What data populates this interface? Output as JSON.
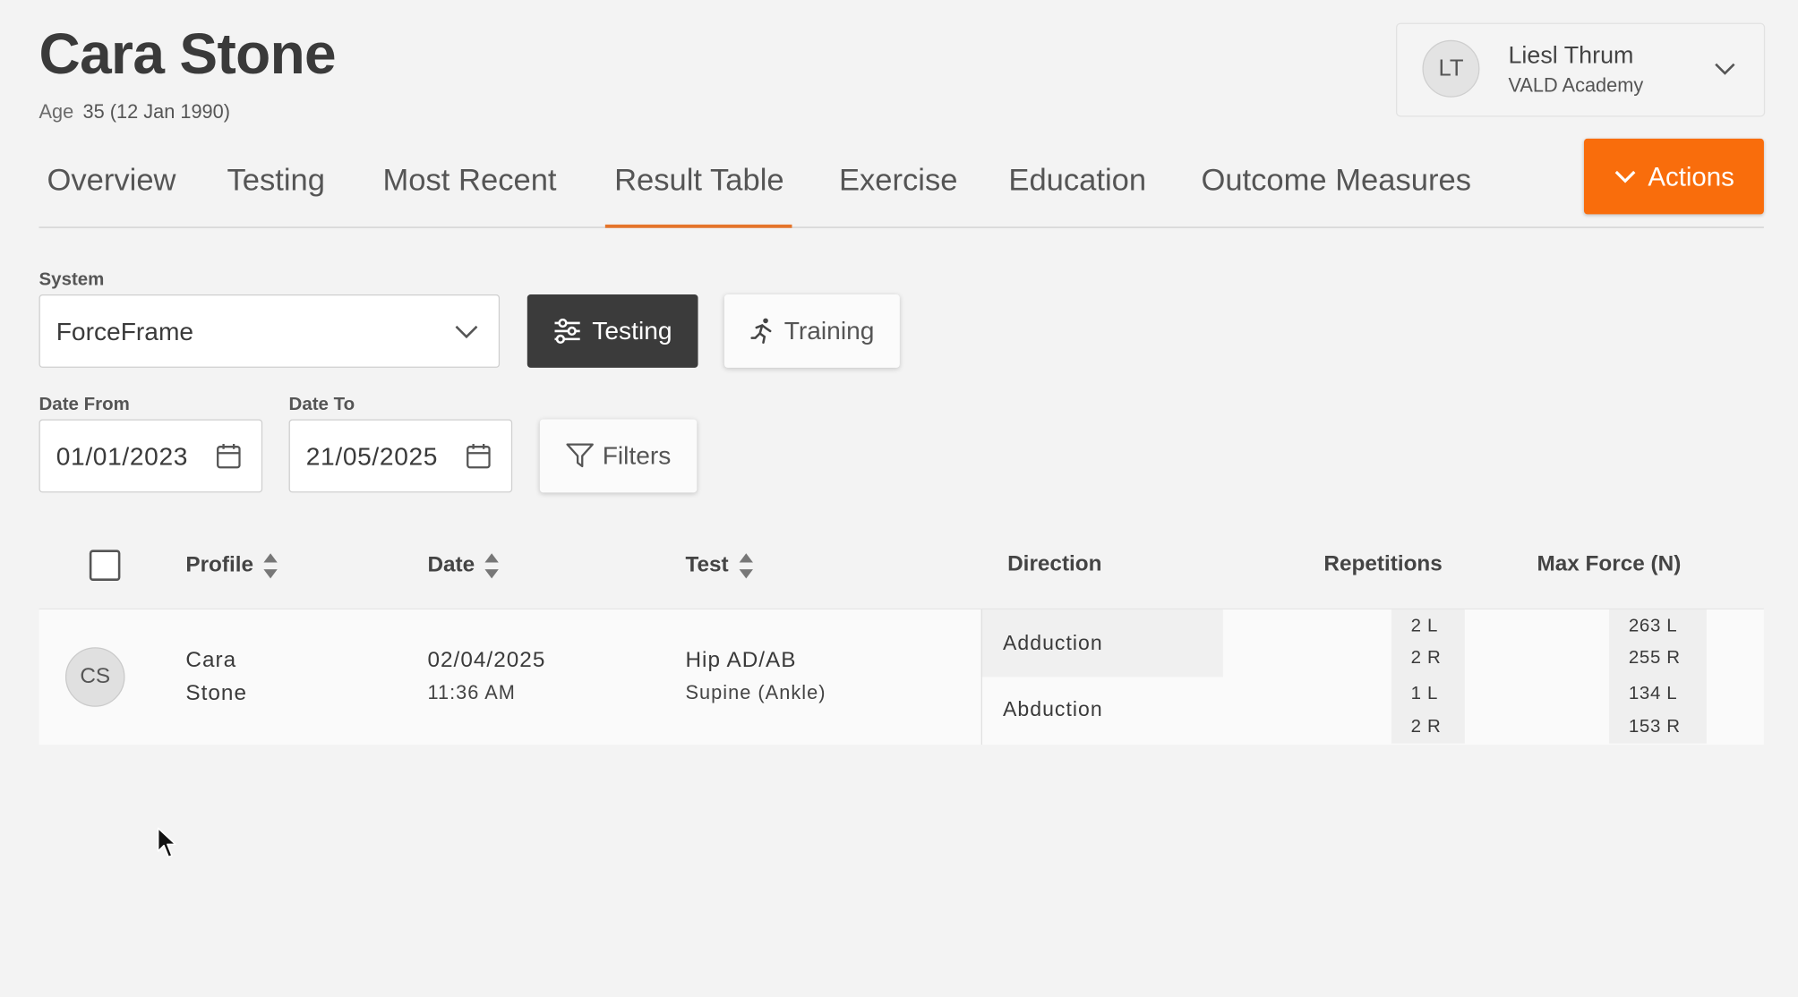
{
  "athlete": {
    "name": "Cara Stone",
    "age_label": "Age",
    "age_value": "35 (12 Jan 1990)"
  },
  "user": {
    "initials": "LT",
    "name": "Liesl Thrum",
    "org": "VALD Academy"
  },
  "tabs": [
    {
      "label": "Overview"
    },
    {
      "label": "Testing"
    },
    {
      "label": "Most Recent"
    },
    {
      "label": "Result Table",
      "active": true
    },
    {
      "label": "Exercise"
    },
    {
      "label": "Education"
    },
    {
      "label": "Outcome Measures"
    }
  ],
  "actions_label": "Actions",
  "filters": {
    "system_label": "System",
    "system_value": "ForceFrame",
    "testing_label": "Testing",
    "training_label": "Training",
    "date_from_label": "Date From",
    "date_from_value": "01/01/2023",
    "date_to_label": "Date To",
    "date_to_value": "21/05/2025",
    "filters_label": "Filters"
  },
  "table": {
    "headers": {
      "profile": "Profile",
      "date": "Date",
      "test": "Test",
      "direction": "Direction",
      "repetitions": "Repetitions",
      "max_force": "Max Force (N)"
    },
    "rows": [
      {
        "initials": "CS",
        "first_name": "Cara",
        "last_name": "Stone",
        "date": "02/04/2025",
        "time": "11:36 AM",
        "test": "Hip AD/AB",
        "position": "Supine (Ankle)",
        "directions": [
          {
            "name": "Adduction",
            "reps": [
              "2 L",
              "2 R"
            ],
            "force": [
              "263 L",
              "255 R"
            ]
          },
          {
            "name": "Abduction",
            "reps": [
              "1 L",
              "2 R"
            ],
            "force": [
              "134 L",
              "153 R"
            ]
          }
        ]
      }
    ]
  },
  "colors": {
    "accent": "#f96d0c",
    "tab_active": "#e5742a",
    "dark_button": "#3b3b3b"
  }
}
